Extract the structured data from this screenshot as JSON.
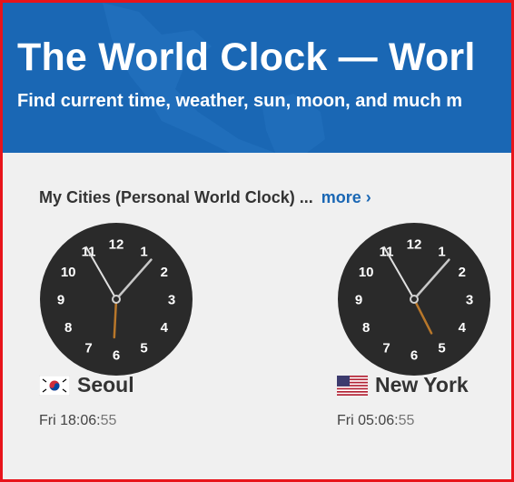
{
  "banner": {
    "title": "The World Clock — Worl",
    "subtitle": "Find current time, weather, sun, moon, and much m"
  },
  "section": {
    "heading": "My Cities (Personal World Clock) ...",
    "more_label": "more ›"
  },
  "clock_numbers": [
    "12",
    "1",
    "2",
    "3",
    "4",
    "5",
    "6",
    "7",
    "8",
    "9",
    "10",
    "11"
  ],
  "cities": [
    {
      "name": "Seoul",
      "flag": "south-korea-flag-icon",
      "time": "Fri 18:06:",
      "seconds": "55",
      "hands": {
        "hour": 18,
        "minute": 6,
        "second": 55
      }
    },
    {
      "name": "New York",
      "flag": "usa-flag-icon",
      "time": "Fri 05:06:",
      "seconds": "55",
      "hands": {
        "hour": 5,
        "minute": 6,
        "second": 55
      }
    }
  ],
  "colors": {
    "banner": "#1a67b4",
    "border": "#e8141b",
    "link": "#1a67b4",
    "dial": "#2a2a2a",
    "hour_hand": "#b8772a",
    "minute_hand": "#c8c8c8"
  }
}
